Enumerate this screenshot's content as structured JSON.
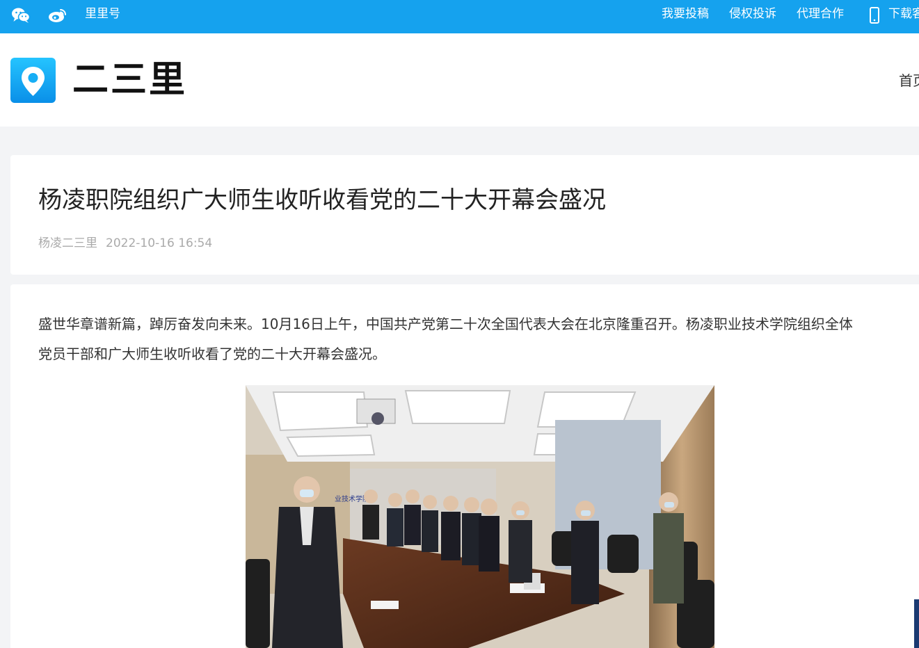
{
  "topbar": {
    "wechat_icon": "wechat-icon",
    "weibo_icon": "weibo-icon",
    "lilihao": "里里号",
    "submit": "我要投稿",
    "complaint": "侵权投诉",
    "agent": "代理合作",
    "phone_icon": "mobile-phone-icon",
    "download": "下载客",
    "bar_color": "#15a2ee"
  },
  "header": {
    "logo_icon": "location-pin-icon",
    "site_name": "二三里",
    "nav_home": "首页"
  },
  "article": {
    "title": "杨凌职院组织广大师生收听收看党的二十大开幕会盛况",
    "source": "杨凌二三里",
    "datetime": "2022-10-16 16:54",
    "paragraph_line1": "盛世华章谱新篇，踔厉奋发向未来。10月16日上午，中国共产党第二十次全国代表大会在北京隆重召开。杨凌职业技术学院组织全体",
    "paragraph_line2": "党员干部和广大师生收听收看了党的二十大开幕会盛况。",
    "sign_text": "业技术学院"
  }
}
